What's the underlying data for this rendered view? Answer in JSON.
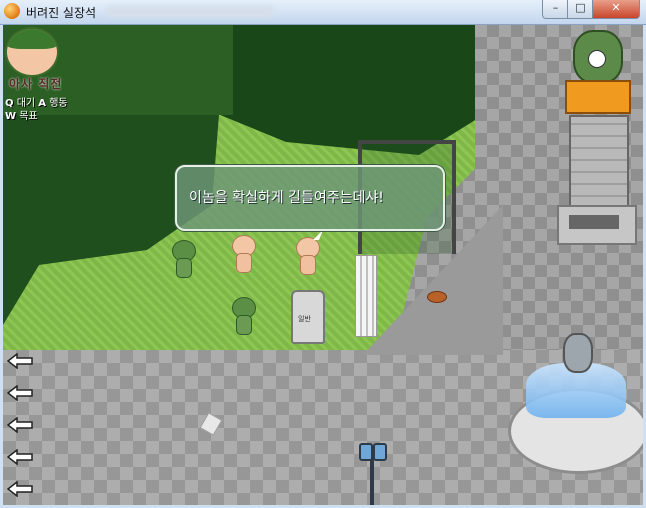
{
  "window": {
    "title": "버려진 실장석",
    "buttons": {
      "minimize": "–",
      "maximize": "□",
      "close": "✕"
    }
  },
  "hud": {
    "status": "아사 직전",
    "controls": [
      {
        "key": "Q",
        "label": "대기",
        "key2": "A",
        "label2": "행동"
      },
      {
        "key": "W",
        "label": "목표"
      }
    ]
  },
  "dialog": {
    "text": "이놈을 확실하게 길들여주는데샤!"
  },
  "map_objects": {
    "trashcan_label": "일반"
  },
  "left_arrows": [
    "back-arrow",
    "back-arrow",
    "back-arrow",
    "back-arrow",
    "back-arrow"
  ],
  "icons": {
    "app": "orange-orb-icon",
    "bread": "bread-icon",
    "paper": "paper-icon",
    "statue": "clock-statue-icon",
    "fountain": "fountain-icon",
    "lamp": "street-lamp-icon"
  },
  "colors": {
    "grass": "#8cc653",
    "forest": "#1f4f1c",
    "road": "#a6a6a6",
    "dialog_bg": "#6e9678",
    "status_text": "#5a2a28"
  }
}
